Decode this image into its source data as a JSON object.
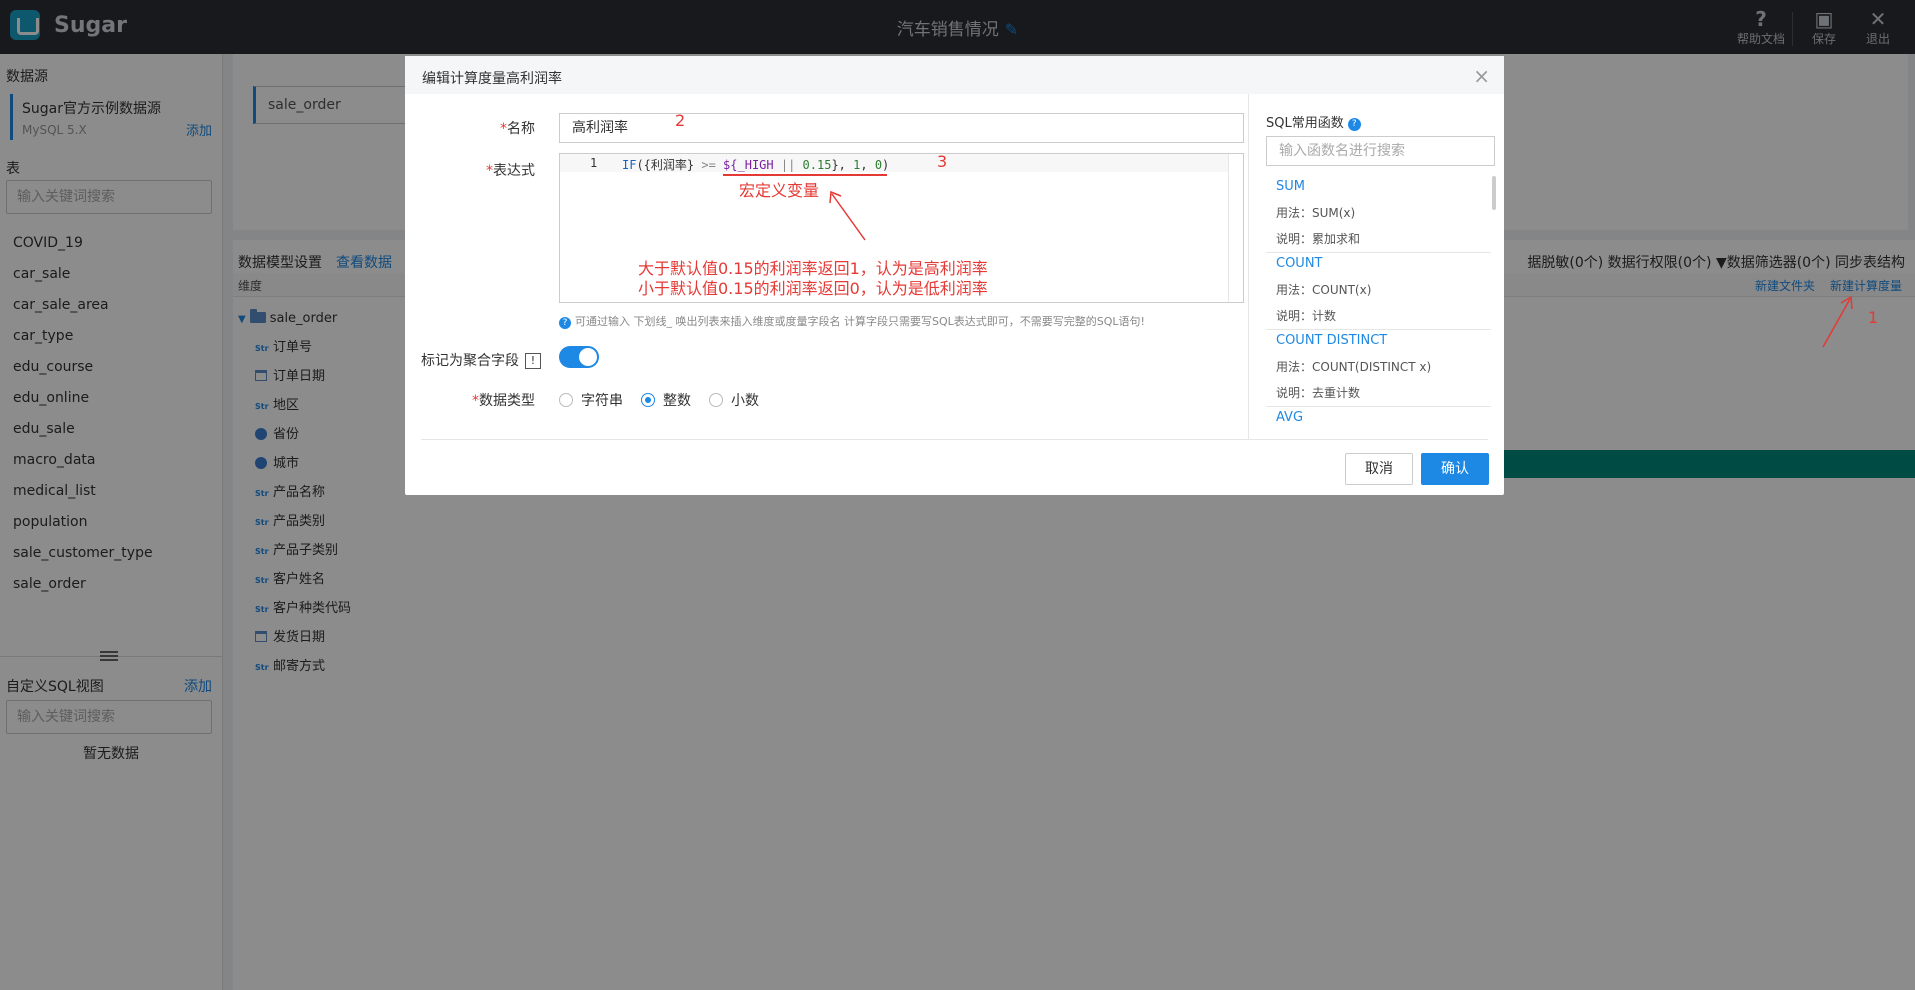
{
  "app": {
    "logo": "Sugar",
    "page_title": "汽车销售情况"
  },
  "top_actions": [
    {
      "label": "帮助文档",
      "icon": "?"
    },
    {
      "label": "保存",
      "icon": "▣"
    },
    {
      "label": "退出",
      "icon": "✕"
    }
  ],
  "sidebar": {
    "datasource_title": "数据源",
    "datasource_name": "Sugar官方示例数据源",
    "datasource_type": "MySQL 5.X",
    "add_label": "添加",
    "tables_title": "表",
    "table_search_placeholder": "输入关键词搜索",
    "tables": [
      "COVID_19",
      "car_sale",
      "car_sale_area",
      "car_type",
      "edu_course",
      "edu_online",
      "edu_sale",
      "macro_data",
      "medical_list",
      "population",
      "sale_customer_type",
      "sale_order"
    ],
    "custom_sql_title": "自定义SQL视图",
    "custom_sql_add": "添加",
    "custom_sql_search_placeholder": "输入关键词搜索",
    "empty_text": "暂无数据"
  },
  "main": {
    "selected_table": "sale_order",
    "model_tab": "数据模型设置",
    "view_data_tab": "查看数据",
    "model_right_items": "据脱敏(0个)  数据行权限(0个)  ▼数据筛选器(0个)  同步表结构",
    "dim_header": "维度",
    "new_folder": "新建文件夹",
    "new_calc_measure": "新建计算度量",
    "root_table": "sale_order",
    "dimensions": [
      {
        "name": "订单号",
        "type": "str"
      },
      {
        "name": "订单日期",
        "type": "date"
      },
      {
        "name": "地区",
        "type": "str"
      },
      {
        "name": "省份",
        "type": "geo"
      },
      {
        "name": "城市",
        "type": "geo"
      },
      {
        "name": "产品名称",
        "type": "str"
      },
      {
        "name": "产品类别",
        "type": "str"
      },
      {
        "name": "产品子类别",
        "type": "str"
      },
      {
        "name": "客户姓名",
        "type": "str"
      },
      {
        "name": "客户种类代码",
        "type": "str"
      },
      {
        "name": "发货日期",
        "type": "date"
      },
      {
        "name": "邮寄方式",
        "type": "str"
      }
    ]
  },
  "dialog": {
    "title": "编辑计算度量高利润率",
    "name_label": "名称",
    "name_value": "高利润率",
    "expr_label": "表达式",
    "line_number": "1",
    "code": {
      "kw": "IF",
      "p1": "({利润率} ",
      "op1": ">=",
      "p2": " ",
      "var": "${_HIGH ",
      "op2": "||",
      "p3": " ",
      "num1": "0.15",
      "p4": "}, ",
      "num2": "1",
      "p5": ", ",
      "num3": "0",
      "p6": ")"
    },
    "hint": "可通过输入 下划线_ 唤出列表来插入维度或度量字段名     计算字段只需要写SQL表达式即可，不需要写完整的SQL语句!",
    "agg_label": "标记为聚合字段",
    "agg_tip": "!",
    "agg_on": true,
    "type_label": "数据类型",
    "types": [
      {
        "label": "字符串",
        "selected": false
      },
      {
        "label": "整数",
        "selected": true
      },
      {
        "label": "小数",
        "selected": false
      }
    ],
    "cancel": "取消",
    "confirm": "确认",
    "sql_panel": {
      "title": "SQL常用函数",
      "search_placeholder": "输入函数名进行搜索",
      "functions": [
        {
          "name": "SUM",
          "usage": "用法：SUM(x)",
          "desc": "说明：累加求和"
        },
        {
          "name": "COUNT",
          "usage": "用法：COUNT(x)",
          "desc": "说明：计数"
        },
        {
          "name": "COUNT DISTINCT",
          "usage": "用法：COUNT(DISTINCT x)",
          "desc": "说明：去重计数"
        },
        {
          "name": "AVG",
          "usage": "",
          "desc": ""
        }
      ]
    }
  },
  "annotations": {
    "n1": "1",
    "n2": "2",
    "n3": "3",
    "macro": "宏定义变量",
    "line1": "大于默认值0.15的利润率返回1，认为是高利润率",
    "line2": "小于默认值0.15的利润率返回0，认为是低利润率",
    "color": "#e53935"
  },
  "colors": {
    "accent": "#1e88e5",
    "topbar": "#2b2f36",
    "teal": "#00897b"
  }
}
